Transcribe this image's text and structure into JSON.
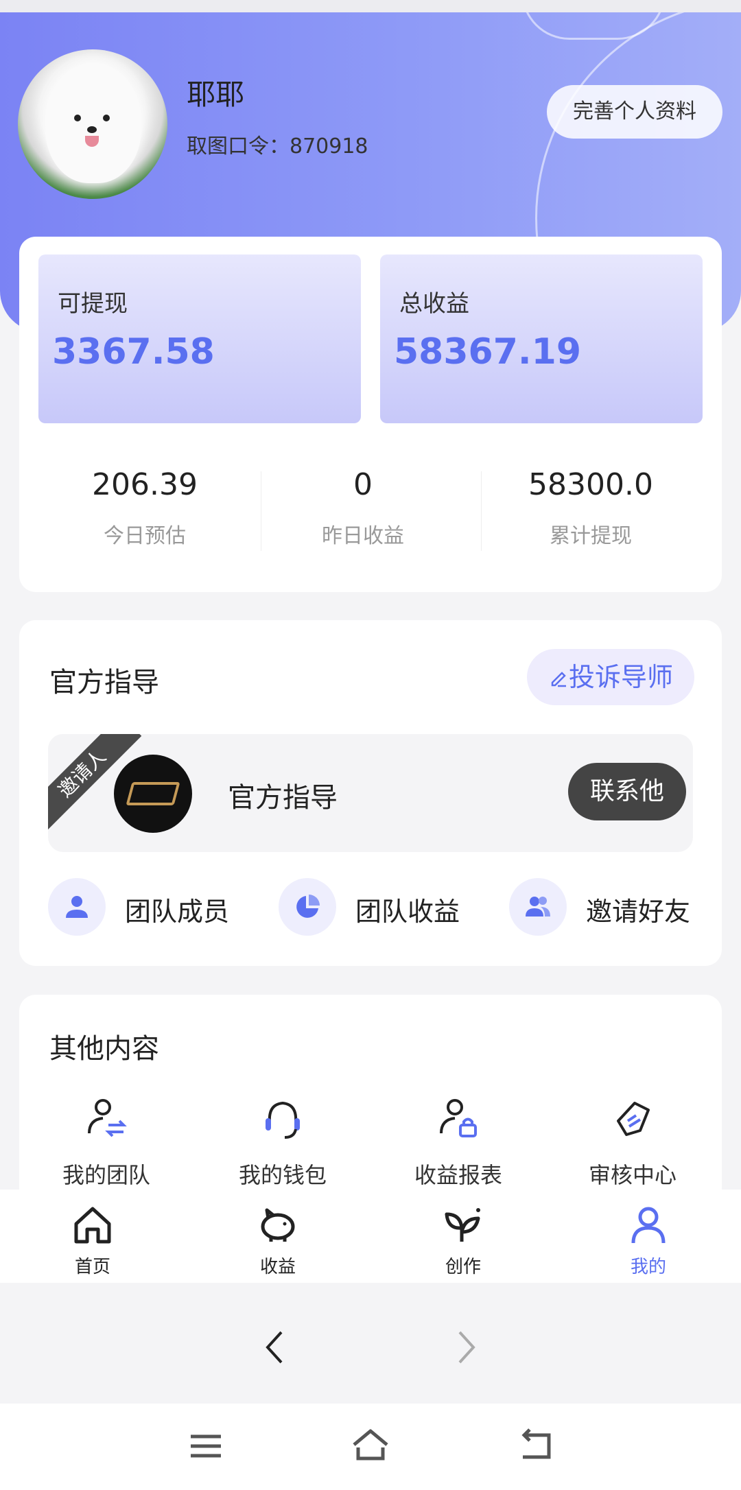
{
  "header": {
    "user_name": "耶耶",
    "pickup_code": "取图口令：870918",
    "complete_profile_label": "完善个人资料"
  },
  "earnings": {
    "withdrawable_label": "可提现",
    "withdrawable_value": "3367.58",
    "total_label": "总收益",
    "total_value": "58367.19",
    "stats": [
      {
        "value": "206.39",
        "label": "今日预估"
      },
      {
        "value": "0",
        "label": "昨日收益"
      },
      {
        "value": "58300.0",
        "label": "累计提现"
      }
    ]
  },
  "guide": {
    "title": "官方指导",
    "complain_label": "投诉导师",
    "inviter_tag": "邀请人",
    "mentor_name": "官方指导",
    "contact_label": "联系他",
    "team": [
      {
        "label": "团队成员",
        "icon": "person-icon"
      },
      {
        "label": "团队收益",
        "icon": "pie-chart-icon"
      },
      {
        "label": "邀请好友",
        "icon": "people-icon"
      }
    ]
  },
  "other": {
    "title": "其他内容",
    "items": [
      {
        "label": "我的团队",
        "icon": "team-transfer-icon"
      },
      {
        "label": "我的钱包",
        "icon": "headset-icon"
      },
      {
        "label": "收益报表",
        "icon": "user-lock-icon"
      },
      {
        "label": "审核中心",
        "icon": "tag-icon"
      }
    ]
  },
  "tabbar": {
    "items": [
      {
        "label": "首页",
        "icon": "home-icon"
      },
      {
        "label": "收益",
        "icon": "piggy-bank-icon"
      },
      {
        "label": "创作",
        "icon": "sprout-icon"
      },
      {
        "label": "我的",
        "icon": "user-icon",
        "active": true
      }
    ]
  },
  "colors": {
    "accent": "#5a6ff0",
    "header_start": "#7b83f4",
    "header_end": "#a3aef8"
  }
}
